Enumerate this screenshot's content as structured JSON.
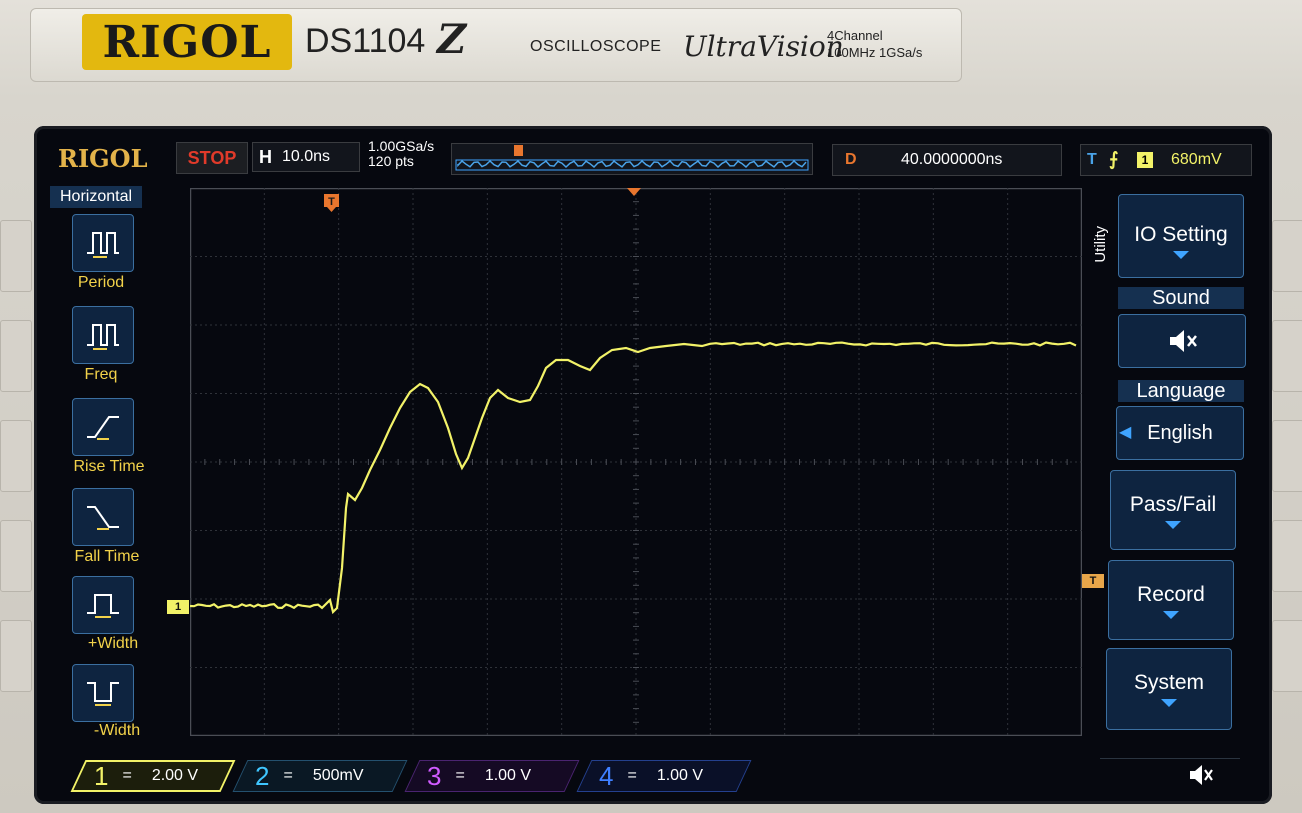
{
  "bezel": {
    "brand": "RIGOL",
    "model": "DS1104",
    "model_suffix": "Z",
    "product_type": "OSCILLOSCOPE",
    "series": "UltraVision",
    "spec_line1": "4Channel",
    "spec_line2": "100MHz  1GSa/s"
  },
  "status_bar": {
    "logo": "RIGOL",
    "run_state": "STOP",
    "h_label": "H",
    "timebase": "10.0ns",
    "sample_rate": "1.00GSa/s",
    "points": "120 pts",
    "delay_label": "D",
    "delay_value": "40.0000000ns",
    "trigger_label": "T",
    "trigger_source": "1",
    "trigger_level": "680mV"
  },
  "left_menu": {
    "title": "Horizontal",
    "items": [
      {
        "label": "Period",
        "icon": "period-icon"
      },
      {
        "label": "Freq",
        "icon": "freq-icon"
      },
      {
        "label": "Rise Time",
        "icon": "rise-time-icon"
      },
      {
        "label": "Fall Time",
        "icon": "fall-time-icon"
      },
      {
        "label": "+Width",
        "icon": "pos-width-icon"
      },
      {
        "label": "-Width",
        "icon": "neg-width-icon"
      }
    ]
  },
  "right_menu": {
    "section": "Utility",
    "io_setting": "IO Setting",
    "sound_header": "Sound",
    "language_header": "Language",
    "language_value": "English",
    "pass_fail": "Pass/Fail",
    "record": "Record",
    "system": "System"
  },
  "channels": [
    {
      "num": "1",
      "coupling": "=",
      "scale": "2.00 V",
      "color": "#f2f268"
    },
    {
      "num": "2",
      "coupling": "=",
      "scale": "500mV",
      "color": "#3fc6ff"
    },
    {
      "num": "3",
      "coupling": "=",
      "scale": "1.00 V",
      "color": "#d05bff"
    },
    {
      "num": "4",
      "coupling": "=",
      "scale": "1.00 V",
      "color": "#3f7fff"
    }
  ],
  "markers": {
    "ch1_marker": "1",
    "trigger_marker": "T"
  },
  "colors": {
    "ch1": "#f2f268",
    "trigger": "#e8762e",
    "grid": "#3a3d44",
    "menu_bg": "#0e2440"
  }
}
